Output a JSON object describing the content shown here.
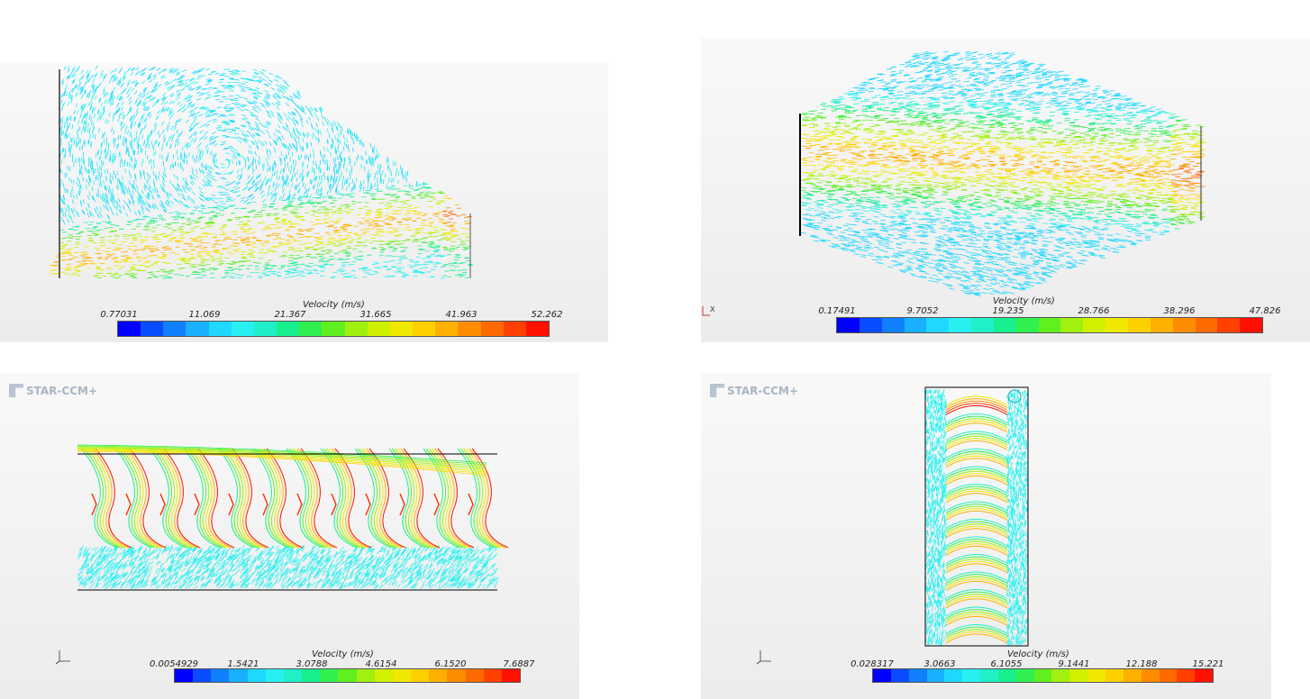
{
  "panels": [
    {
      "id": "p1",
      "legend_title": "Velocity (m/s)",
      "ticks": [
        "0.77031",
        "11.069",
        "21.367",
        "31.665",
        "41.963",
        "52.262"
      ],
      "watermark": ""
    },
    {
      "id": "p2",
      "legend_title": "Velocity (m/s)",
      "ticks": [
        "0.17491",
        "9.7052",
        "19.235",
        "28.766",
        "38.296",
        "47.826"
      ],
      "watermark": "",
      "axis_triad": "X"
    },
    {
      "id": "p3",
      "legend_title": "Velocity (m/s)",
      "ticks": [
        "0.0054929",
        "1.5421",
        "3.0788",
        "4.6154",
        "6.1520",
        "7.6887"
      ],
      "watermark": "STAR-CCM+",
      "axis_triad": "Y Z X"
    },
    {
      "id": "p4",
      "legend_title": "Velocity (m/s)",
      "ticks": [
        "0.028317",
        "3.0663",
        "6.1055",
        "9.1441",
        "12.188",
        "15.221"
      ],
      "watermark": "STAR-CCM+",
      "axis_triad": "Y Z X"
    }
  ],
  "colormap": [
    "#0000ff",
    "#0a4cff",
    "#1080ff",
    "#18b0ff",
    "#20d8ff",
    "#28f0f0",
    "#20f0c8",
    "#18f090",
    "#30f050",
    "#60f020",
    "#a0f010",
    "#d0f000",
    "#f0e800",
    "#ffd000",
    "#ffb000",
    "#ff8c00",
    "#ff6a00",
    "#ff4000",
    "#ff1000"
  ]
}
